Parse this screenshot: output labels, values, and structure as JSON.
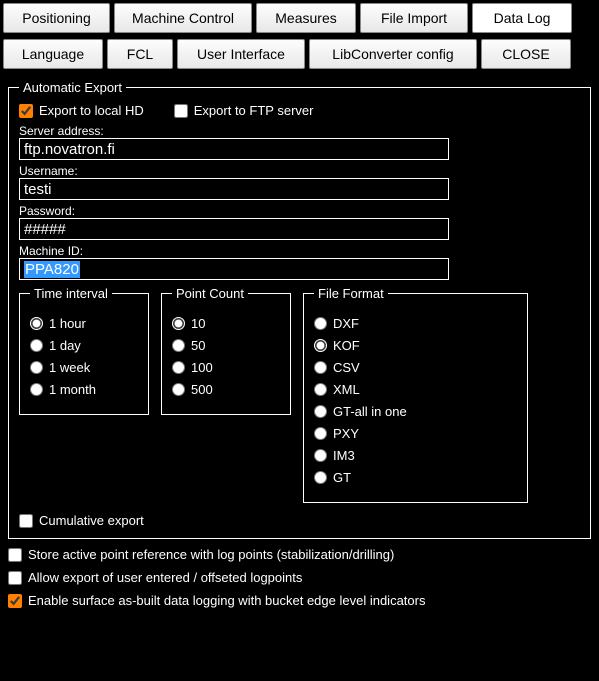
{
  "tabs_row1": {
    "positioning": "Positioning",
    "machine_control": "Machine Control",
    "measures": "Measures",
    "file_import": "File Import",
    "data_log": "Data Log"
  },
  "tabs_row2": {
    "language": "Language",
    "fcl": "FCL",
    "user_interface": "User Interface",
    "libconverter": "LibConverter config",
    "close": "CLOSE"
  },
  "auto_export": {
    "legend": "Automatic Export",
    "export_local": "Export to local HD",
    "export_ftp": "Export to FTP server",
    "server_address_label": "Server address:",
    "server_address": "ftp.novatron.fi",
    "username_label": "Username:",
    "username": "testi",
    "password_label": "Password:",
    "password": "#####",
    "machine_id_label": "Machine ID:",
    "machine_id": "PPA820",
    "time_interval": {
      "legend": "Time interval",
      "h1": "1 hour",
      "d1": "1 day",
      "w1": "1 week",
      "m1": "1 month"
    },
    "point_count": {
      "legend": "Point Count",
      "p10": "10",
      "p50": "50",
      "p100": "100",
      "p500": "500"
    },
    "file_format": {
      "legend": "File Format",
      "dxf": "DXF",
      "kof": "KOF",
      "csv": "CSV",
      "xml": "XML",
      "gtall": "GT-all in one",
      "pxy": "PXY",
      "im3": "IM3",
      "gt": "GT"
    },
    "cumulative": "Cumulative export"
  },
  "bottom": {
    "store_active": "Store active point reference with log points (stabilization/drilling)",
    "allow_export": "Allow export of user entered / offseted logpoints",
    "enable_surface": "Enable surface as-built data logging with bucket edge level indicators"
  }
}
